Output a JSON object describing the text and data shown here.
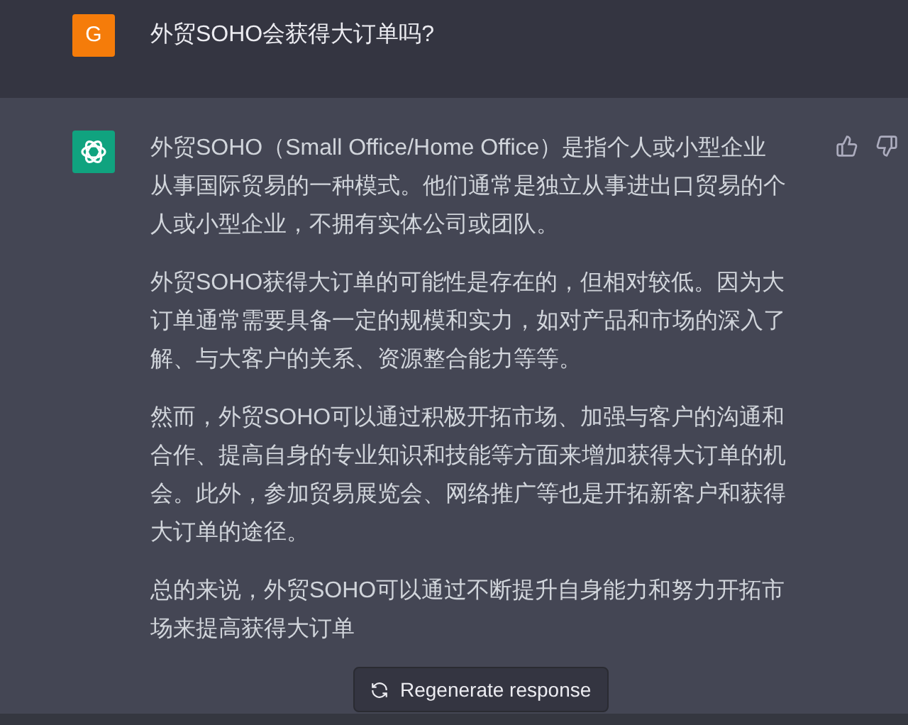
{
  "user_message": {
    "avatar": "G",
    "text": "外贸SOHO会获得大订单吗?"
  },
  "assistant_message": {
    "paragraphs": [
      {
        "lines": [
          "外贸SOHO（Small Office/Home Office）是指个人或小型企业",
          "从事国际贸易的一种模式。他们通常是独立从事进出口贸易的个",
          "人或小型企业，不拥有实体公司或团队。"
        ]
      },
      {
        "lines": [
          "外贸SOHO获得大订单的可能性是存在的，但相对较低。因为大",
          "订单通常需要具备一定的规模和实力，如对产品和市场的深入了",
          "解、与大客户的关系、资源整合能力等等。"
        ]
      },
      {
        "lines": [
          "然而，外贸SOHO可以通过积极开拓市场、加强与客户的沟通和",
          "合作、提高自身的专业知识和技能等方面来增加获得大订单的机",
          "会。此外，参加贸易展览会、网络推广等也是开拓新客户和获得",
          "大订单的途径。"
        ]
      },
      {
        "lines": [
          "总的来说，外贸SOHO可以通过不断提升自身能力和努力开拓市",
          "场来提高获得大订单"
        ]
      }
    ]
  },
  "regenerate_button": {
    "label": "Regenerate response"
  }
}
